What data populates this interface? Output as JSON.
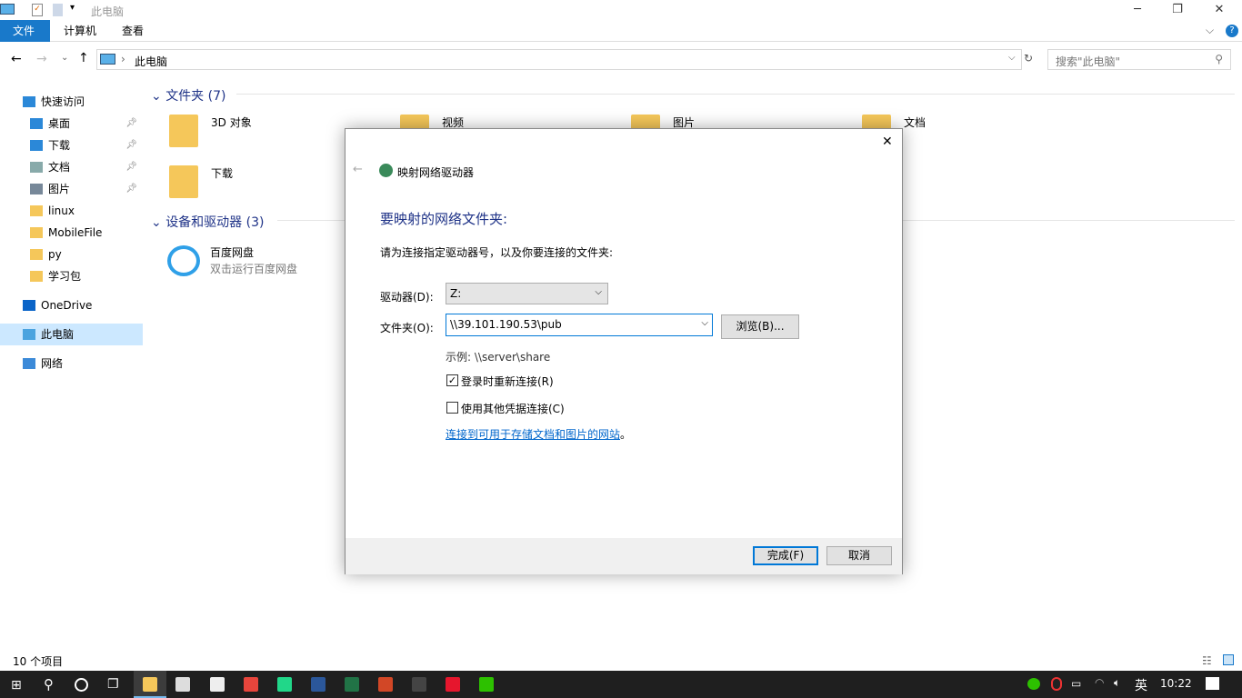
{
  "window": {
    "title": "此电脑",
    "minimize": "─",
    "restore": "❐",
    "close": "✕"
  },
  "ribbon": {
    "tabs": [
      "文件",
      "计算机",
      "查看"
    ],
    "help": "?",
    "expand": "⌵"
  },
  "address": {
    "path": "此电脑",
    "search_placeholder": "搜索\"此电脑\""
  },
  "nav": {
    "items": [
      {
        "label": "快速访问",
        "icon": "star-icon",
        "color": "#2b88d8"
      },
      {
        "label": "桌面",
        "icon": "desktop-icon",
        "color": "#2b88d8",
        "pinned": true
      },
      {
        "label": "下载",
        "icon": "download-icon",
        "color": "#2b88d8",
        "pinned": true
      },
      {
        "label": "文档",
        "icon": "document-icon",
        "color": "#8aa",
        "pinned": true
      },
      {
        "label": "图片",
        "icon": "pictures-icon",
        "color": "#789",
        "pinned": true
      },
      {
        "label": "linux",
        "icon": "folder-icon",
        "color": "#f5c75a"
      },
      {
        "label": "MobileFile",
        "icon": "folder-icon",
        "color": "#f5c75a"
      },
      {
        "label": "py",
        "icon": "folder-icon",
        "color": "#f5c75a"
      },
      {
        "label": "学习包",
        "icon": "folder-icon",
        "color": "#f5c75a"
      },
      {
        "label": "OneDrive",
        "icon": "cloud-icon",
        "color": "#0a64c8"
      },
      {
        "label": "此电脑",
        "icon": "computer-icon",
        "color": "#4aa3df",
        "selected": true
      },
      {
        "label": "网络",
        "icon": "network-icon",
        "color": "#3c8ad8"
      }
    ]
  },
  "content": {
    "folders_header": "文件夹 (7)",
    "folders": [
      "3D 对象",
      "视频",
      "图片",
      "文档",
      "下载"
    ],
    "devices_header": "设备和驱动器 (3)",
    "devices": [
      {
        "name": "百度网盘",
        "desc": "双击运行百度网盘"
      }
    ]
  },
  "status": {
    "count": "10 个项目"
  },
  "dialog": {
    "title": "映射网络驱动器",
    "heading": "要映射的网络文件夹:",
    "instruction": "请为连接指定驱动器号，以及你要连接的文件夹:",
    "drive_label": "驱动器(D):",
    "drive_value": "Z:",
    "folder_label": "文件夹(O):",
    "folder_value": "\\\\39.101.190.53\\pub",
    "browse": "浏览(B)...",
    "example": "示例: \\\\server\\share",
    "reconnect": "登录时重新连接(R)",
    "reconnect_checked": true,
    "other_creds": "使用其他凭据连接(C)",
    "other_creds_checked": false,
    "link": "连接到可用于存储文档和图片的网站",
    "link_suffix": "。",
    "finish": "完成(F)",
    "cancel": "取消",
    "close": "✕",
    "back": "←"
  },
  "taskbar": {
    "ime": "英",
    "time": "10:22",
    "apps": [
      {
        "name": "file-explorer",
        "color": "#f5c75a"
      },
      {
        "name": "store",
        "color": "#ddd"
      },
      {
        "name": "mail",
        "color": "#eee"
      },
      {
        "name": "chrome",
        "color": "#e8453c"
      },
      {
        "name": "pycharm",
        "color": "#21d789"
      },
      {
        "name": "word",
        "color": "#2b579a"
      },
      {
        "name": "excel",
        "color": "#217346"
      },
      {
        "name": "powerpoint",
        "color": "#d24726"
      },
      {
        "name": "cmd",
        "color": "#444"
      },
      {
        "name": "weibo",
        "color": "#e6162d"
      },
      {
        "name": "wechat",
        "color": "#2dc100"
      }
    ]
  }
}
